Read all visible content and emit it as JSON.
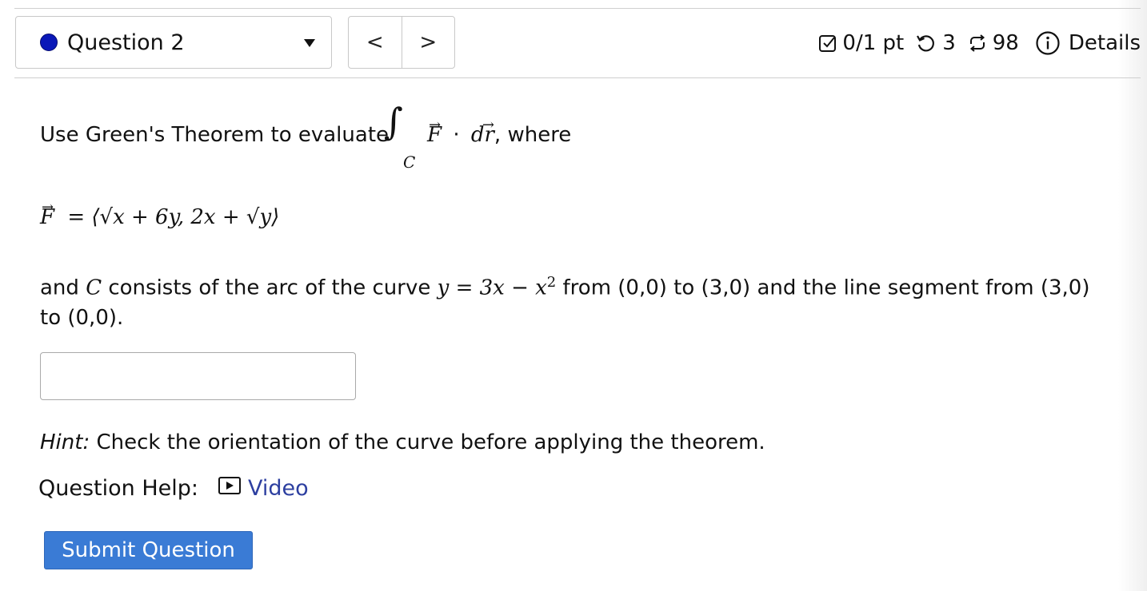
{
  "header": {
    "question_label": "Question 2",
    "nav_prev": "<",
    "nav_next": ">",
    "score": "0/1 pt",
    "attempts": "3",
    "submissions": "98",
    "details": "Details"
  },
  "problem": {
    "intro_text": "Use Green's Theorem to evaluate",
    "intro_suffix": ", where",
    "integral_symbol": "∫",
    "integral_subscript": "C",
    "integrand_field": "F",
    "integrand_dot": "·",
    "integrand_dr": "dr",
    "field_lhs": "F",
    "field_rhs": "= ⟨√x + 6y, 2x + √y⟩",
    "curve_text_start": "and",
    "curve_symbol": "C",
    "curve_text_mid": "consists of the arc of the curve",
    "curve_equation": "y = 3x − x",
    "curve_exponent": "2",
    "curve_text_end": "from (0,0) to (3,0) and the line segment from (3,0)",
    "curve_text_line2": "to (0,0)."
  },
  "answer": {
    "value": ""
  },
  "hint": {
    "label": "Hint:",
    "text": "Check the orientation of the curve before applying the theorem."
  },
  "help": {
    "label": "Question Help:",
    "video_label": "Video"
  },
  "submit": {
    "label": "Submit Question"
  },
  "colors": {
    "accent": "#3a7bd5",
    "dot": "#0a18b8",
    "link": "#2d3fa0"
  }
}
